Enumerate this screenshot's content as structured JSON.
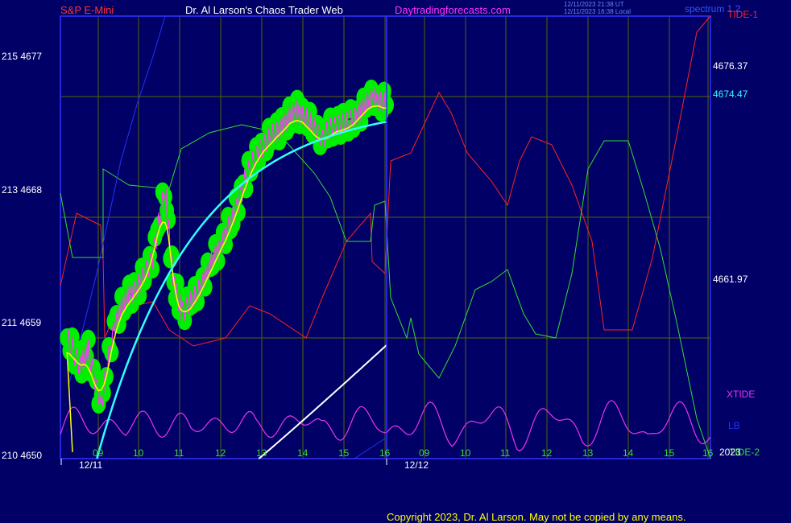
{
  "header": {
    "symbol": "S&P E-Mini",
    "title": "Dr. Al Larson's Chaos Trader Web",
    "site": "Daytradingforecasts.com",
    "timestamp_utc": "12/11/2023 21:38 UT",
    "timestamp_local": "12/11/2023 16:38 Local",
    "spectrum_label": "spectrum 1.2",
    "tide1_label": "TIDE-1"
  },
  "y_axis_labels": [
    {
      "text": "215  4677",
      "price": 4677
    },
    {
      "text": "213  4668",
      "price": 4668
    },
    {
      "text": "211  4659",
      "price": 4659
    },
    {
      "text": "210  4650",
      "price": 4650
    }
  ],
  "right_labels": {
    "price_1": "4676.37",
    "price_2": "4674.47",
    "price_3": "4661.97",
    "xtide": "XTIDE",
    "lb": "LB",
    "tide2": "TIDE-2",
    "year": "2023"
  },
  "colors": {
    "background": "#000066",
    "plot_border": "#3333ff",
    "grid": "#556600",
    "price_dots": "#00ee00",
    "price_line": "#ff33ff",
    "average_yellow": "#ffff00",
    "average_cyan": "#33ffff",
    "forecast_white": "#ffffff",
    "tide1": "#ff2222",
    "tide2": "#33dd33",
    "xtide": "#ee33ee",
    "lb": "#2233ff",
    "header_red": "#ff3333",
    "header_white": "#ffffff",
    "header_magenta": "#ff33ff",
    "copyright": "#ffff00"
  },
  "x_axis": {
    "hour_labels": [
      "09",
      "10",
      "11",
      "12",
      "13",
      "14",
      "15",
      "16",
      "09",
      "10",
      "11",
      "12",
      "13",
      "14",
      "15",
      "16"
    ],
    "date_labels": [
      "12/11",
      "12/12"
    ]
  },
  "copyright": "Copyright 2023, Dr. Al Larson. May not be copied by any means.",
  "chart_data": {
    "type": "line",
    "ylim": [
      4650,
      4683
    ],
    "y_unit": "price",
    "x_unit": "hour of session",
    "xlim": [
      8.4,
      16.9
    ],
    "grid": true,
    "series": [
      {
        "name": "S&P E-Mini price",
        "color": "#ff33ff",
        "x": [
          8.5,
          8.8,
          9.0,
          9.3,
          9.6,
          9.9,
          10.2,
          10.5,
          10.8,
          11.0,
          11.2,
          11.5,
          11.8,
          12.1,
          12.4,
          12.7,
          13.0,
          13.3,
          13.6,
          13.9,
          14.2,
          14.5,
          14.8,
          15.1,
          15.4,
          15.7,
          16.0
        ],
        "y": [
          4659,
          4657,
          4658,
          4654,
          4660,
          4662,
          4663,
          4665,
          4670,
          4663,
          4661,
          4662,
          4664,
          4666,
          4668,
          4671,
          4673,
          4674,
          4675,
          4676,
          4675,
          4674,
          4675,
          4675,
          4676,
          4677,
          4676.37
        ]
      },
      {
        "name": "XTIDE",
        "color": "#ee33ee",
        "x": [
          8.4,
          8.8,
          9.2,
          9.6,
          10.0,
          10.3,
          10.6,
          10.9,
          11.2,
          11.5,
          11.8,
          12.1,
          12.4,
          12.7,
          13.0,
          13.3,
          13.6,
          13.9,
          14.2,
          14.5,
          14.8,
          15.1,
          15.4,
          15.7,
          16.0,
          16.3,
          16.6,
          16.9
        ],
        "y": [
          4653,
          4651,
          4652.5,
          4651,
          4651.5,
          4653,
          4651,
          4652,
          4651,
          4651.5,
          4652,
          4651,
          4653.5,
          4651,
          4652,
          4654.5,
          4651,
          4653,
          4651,
          4655,
          4652,
          4654,
          4651,
          4652,
          4656,
          4652,
          4651,
          4651.5
        ]
      }
    ]
  }
}
